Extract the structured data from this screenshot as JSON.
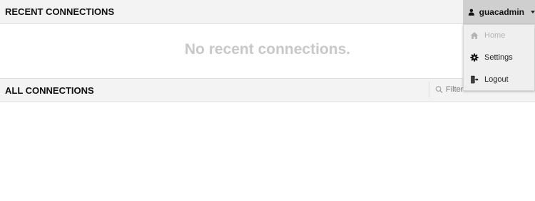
{
  "recent": {
    "title": "RECENT CONNECTIONS",
    "empty_message": "No recent connections."
  },
  "all": {
    "title": "ALL CONNECTIONS",
    "filter_placeholder": "Filter"
  },
  "user_menu": {
    "username": "guacadmin",
    "items": [
      {
        "label": "Home",
        "icon": "home-icon",
        "disabled": true
      },
      {
        "label": "Settings",
        "icon": "gear-icon",
        "disabled": false
      },
      {
        "label": "Logout",
        "icon": "logout-icon",
        "disabled": false
      }
    ]
  },
  "colors": {
    "header_bg": "#f3f3f3",
    "user_menu_bg": "#cfcfcf",
    "empty_text": "#c8c8c8",
    "disabled_text": "#b3b3b3"
  }
}
